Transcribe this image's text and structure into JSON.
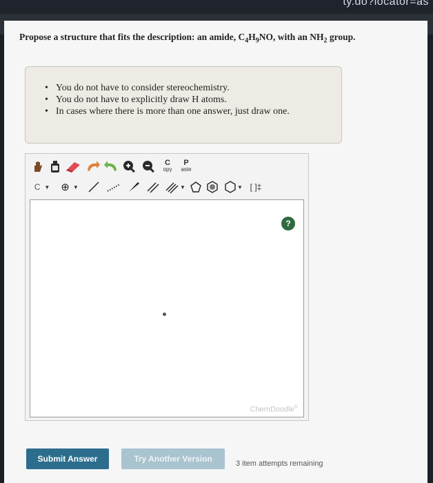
{
  "browser": {
    "url_fragment": "ty.do?locator=as"
  },
  "question": {
    "prefix": "Propose a structure that fits the description: an amide, C",
    "c_sub": "4",
    "h": "H",
    "h_sub": "9",
    "after_formula": "NO, with an NH",
    "nh_sub": "2",
    "suffix": " group."
  },
  "notes": [
    "You do not have to consider stereochemistry.",
    "You do not have to explicitly draw H atoms.",
    "In cases where there is more than one answer, just draw one."
  ],
  "toolbar": {
    "row1": [
      {
        "name": "hand-icon"
      },
      {
        "name": "clear-icon"
      },
      {
        "name": "eraser-icon"
      },
      {
        "name": "undo-icon"
      },
      {
        "name": "redo-icon"
      },
      {
        "name": "zoom-in-icon"
      },
      {
        "name": "zoom-out-icon"
      },
      {
        "name": "copy-button",
        "top": "C",
        "bottom": "opy"
      },
      {
        "name": "paste-button",
        "top": "P",
        "bottom": "aste"
      }
    ],
    "atom_label": "C",
    "charge_label": "⊕",
    "bracket_label": "[ ]‡"
  },
  "canvas": {
    "help_label": "?",
    "watermark": "ChemDoodle"
  },
  "actions": {
    "submit_label": "Submit Answer",
    "another_label": "Try Another Version",
    "attempts_text": "3 item attempts remaining"
  },
  "colors": {
    "submit_bg": "#2c6d8d",
    "another_bg": "#a9c3cf",
    "help_bg": "#2f6b3e"
  }
}
